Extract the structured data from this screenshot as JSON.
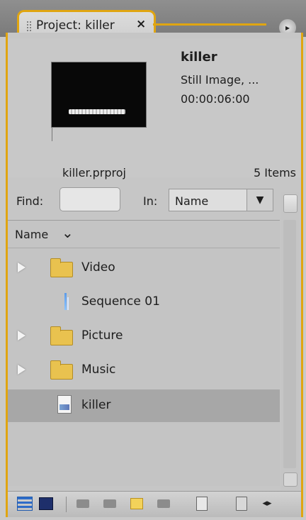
{
  "panel": {
    "tab_title": "Project: killer",
    "tab_close": "×",
    "menu_glyph": "▸"
  },
  "preview": {
    "clip_name": "killer",
    "clip_type": "Still Image, ...",
    "clip_duration": "00:00:06:00"
  },
  "project": {
    "file_name": "killer.prproj",
    "item_count": "5 Items"
  },
  "find": {
    "label": "Find:",
    "value": "",
    "in_label": "In:",
    "in_value": "Name",
    "dropdown_arrow": "▼"
  },
  "list": {
    "header": "Name",
    "sort_glyph": "⌄",
    "items": [
      {
        "label": "Video",
        "type": "folder"
      },
      {
        "label": "Sequence 01",
        "type": "sequence"
      },
      {
        "label": "Picture",
        "type": "folder"
      },
      {
        "label": "Music",
        "type": "folder"
      },
      {
        "label": "killer",
        "type": "still-image",
        "selected": true
      }
    ]
  },
  "toolbar": {
    "nav_arrows": "◂▸"
  },
  "colors": {
    "accent_border": "#e0a511",
    "panel_bg": "#c6c6c6",
    "selected_row": "#a7a7a7"
  }
}
